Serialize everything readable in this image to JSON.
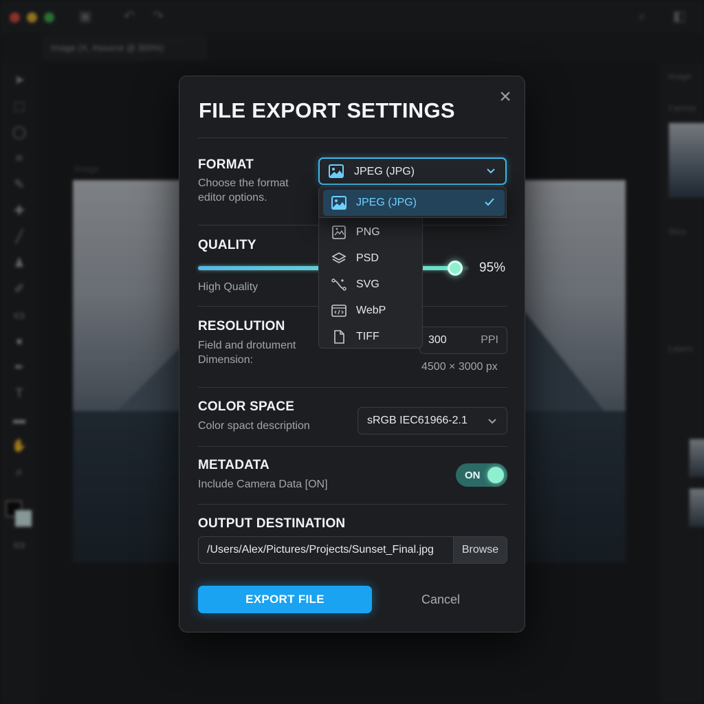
{
  "background_app": {
    "document_tab": "Image (X, #source @ 300%)",
    "canvas_label": "Image",
    "panel_labels": [
      "Image",
      "Canvas",
      "Slice",
      "Layers"
    ]
  },
  "dialog": {
    "title": "FILE EXPORT SETTINGS",
    "close_icon": "close-icon",
    "format": {
      "label": "FORMAT",
      "description": "Choose the format editor options.",
      "selected": "JPEG (JPG)",
      "options": [
        {
          "label": "JPEG (JPG)",
          "icon": "image-icon",
          "selected": true
        },
        {
          "label": "PNG",
          "icon": "png-file-icon",
          "selected": false
        },
        {
          "label": "PSD",
          "icon": "layers-icon",
          "selected": false
        },
        {
          "label": "SVG",
          "icon": "vector-path-icon",
          "selected": false
        },
        {
          "label": "WebP",
          "icon": "webp-code-icon",
          "selected": false
        },
        {
          "label": "TIFF",
          "icon": "document-icon",
          "selected": false
        }
      ]
    },
    "quality": {
      "label": "QUALITY",
      "description": "High Quality",
      "value_text": "95%",
      "value_percent": 95
    },
    "resolution": {
      "label": "RESOLUTION",
      "description": "Field and drotument Dimension:",
      "ppi_value": "300",
      "ppi_unit": "PPI",
      "dimensions": "4500 × 3000 px"
    },
    "color_space": {
      "label": "COLOR SPACE",
      "description": "Color spact description",
      "selected": "sRGB IEC61966-2.1"
    },
    "metadata": {
      "label": "METADATA",
      "description": "Include Camera Data [ON]",
      "toggle_label": "ON",
      "enabled": true
    },
    "output": {
      "label": "OUTPUT DESTINATION",
      "path": "/Users/Alex/Pictures/Projects/Sunset_Final.jpg",
      "browse_label": "Browse"
    },
    "actions": {
      "export_label": "EXPORT FILE",
      "cancel_label": "Cancel"
    }
  },
  "colors": {
    "accent": "#1aa3f0",
    "highlight": "#3fb8ea",
    "toggle_on": "#8ef0cf",
    "dialog_bg": "#1d1e21"
  }
}
